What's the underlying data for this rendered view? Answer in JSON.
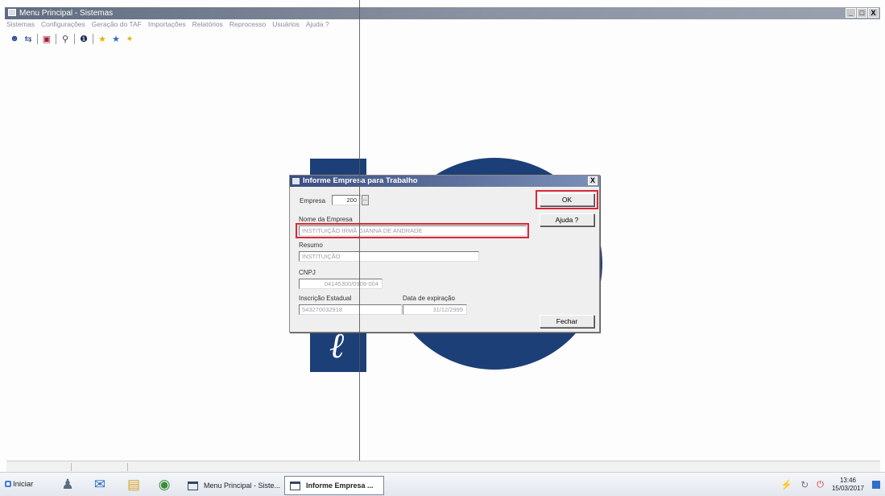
{
  "window": {
    "title": "Menu Principal - Sistemas",
    "controls": [
      "_",
      "□",
      "X"
    ]
  },
  "menu": [
    "Sistemas",
    "Configurações",
    "Geração do TAF",
    "Importações",
    "Relatórios",
    "Reprocesso",
    "Usuários",
    "Ajuda ?"
  ],
  "toolbar": {
    "icons": [
      "people-icon",
      "people-swap-icon",
      "book-icon",
      "lamp-icon",
      "info-icon",
      "star-icon",
      "star-blue-icon",
      "sparkle-icon"
    ]
  },
  "dialog": {
    "title": "Informe Empresa para Trabalho",
    "close": "X",
    "empresa_label": "Empresa",
    "empresa_value": "200",
    "empresa_lookup": "...",
    "nome_label": "Nome da Empresa",
    "nome_value": "INSTITUIÇÃO IRMÃ GIANNA DE ANDRADE",
    "resumo_label": "Resumo",
    "resumo_value": "INSTITUIÇÃO",
    "cnpj_label": "CNPJ",
    "cnpj_value": "04145300/0909-004",
    "inscricao_label": "Inscrição Estadual",
    "inscricao_value": "543270032918",
    "expiracao_label": "Data de expiração",
    "expiracao_value": "31/12/2999",
    "ok_label": "OK",
    "ajuda_label": "Ajuda ?",
    "fechar_label": "Fechar"
  },
  "taskbar": {
    "start_label": "Iniciar",
    "items": [
      {
        "label": "Menu Principal - Siste...",
        "active": false
      },
      {
        "label": "Informe Empresa ...",
        "active": true
      }
    ],
    "clock_time": "13:46",
    "clock_date": "15/03/2017"
  },
  "colors": {
    "highlight": "#d8283a",
    "logo_blue": "#1d3f78",
    "titlebar": "#606c80"
  }
}
